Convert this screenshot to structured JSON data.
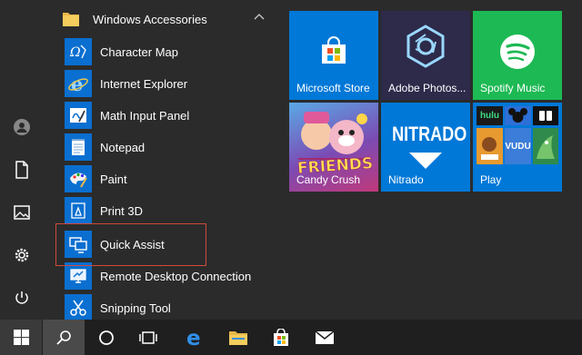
{
  "folder": {
    "label": "Windows Accessories",
    "icon": "folder-icon"
  },
  "apps": [
    {
      "label": "Character Map",
      "icon": "character-map-icon"
    },
    {
      "label": "Internet Explorer",
      "icon": "internet-explorer-icon"
    },
    {
      "label": "Math Input Panel",
      "icon": "math-input-icon"
    },
    {
      "label": "Notepad",
      "icon": "notepad-icon"
    },
    {
      "label": "Paint",
      "icon": "paint-icon"
    },
    {
      "label": "Print 3D",
      "icon": "print-3d-icon"
    },
    {
      "label": "Quick Assist",
      "icon": "quick-assist-icon"
    },
    {
      "label": "Remote Desktop Connection",
      "icon": "remote-desktop-icon"
    },
    {
      "label": "Snipping Tool",
      "icon": "snipping-tool-icon"
    }
  ],
  "tiles": {
    "store": {
      "label": "Microsoft Store",
      "color": "#0078d7"
    },
    "photoshop": {
      "label": "Adobe Photos...",
      "color": "#2d2a4a"
    },
    "spotify": {
      "label": "Spotify Music",
      "color": "#1db954"
    },
    "candy": {
      "label": "Candy Crush",
      "logo": "FRIENDS",
      "color": "#6a3c9c"
    },
    "nitrado": {
      "label": "Nitrado",
      "logo": "NITRADO",
      "color": "#0078d7"
    },
    "play": {
      "label": "Play",
      "color": "#0078d7",
      "badges": [
        "hulu",
        "VUDU"
      ]
    }
  },
  "rail": [
    "user-icon",
    "documents-icon",
    "pictures-icon",
    "settings-icon",
    "power-icon"
  ],
  "taskbar": [
    "windows-start-icon",
    "search-icon",
    "cortana-icon",
    "task-view-icon",
    "edge-icon",
    "file-explorer-icon",
    "store-icon",
    "mail-icon"
  ],
  "colors": {
    "accent": "#0078d7",
    "highlight_border": "#d04a3a",
    "background": "#2b2b2b",
    "taskbar": "#1f1f1f"
  }
}
